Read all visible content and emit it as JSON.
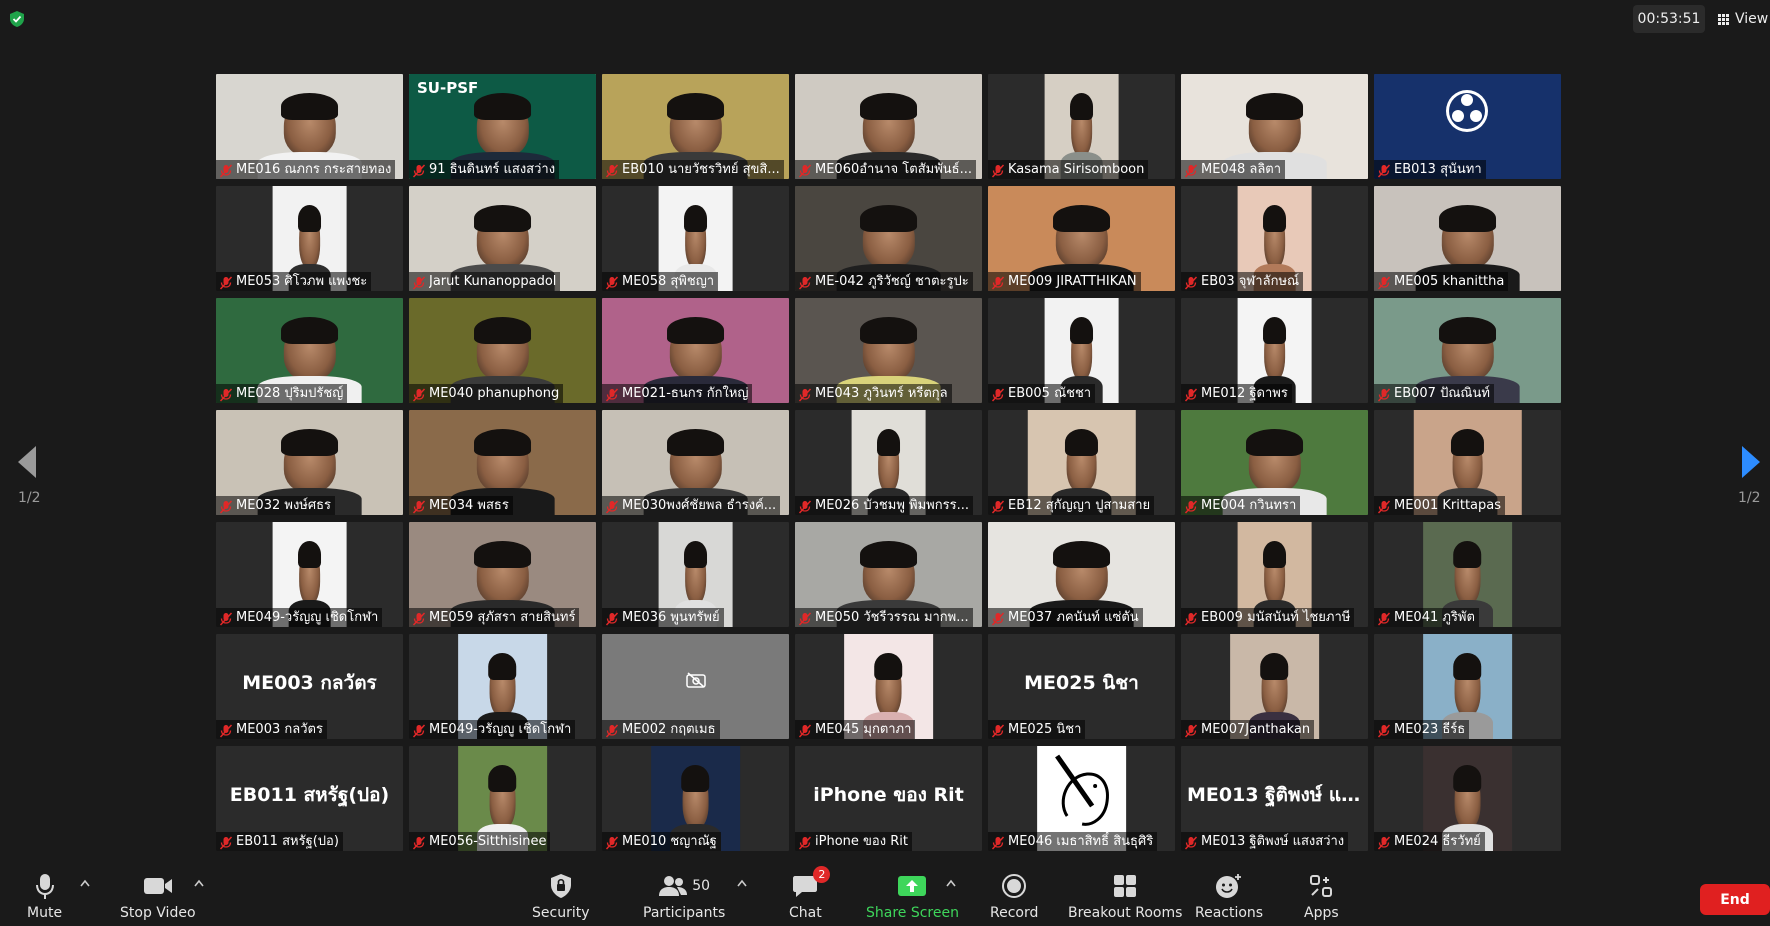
{
  "meeting": {
    "timer": "00:53:51",
    "view_label": "View",
    "page_indicator_left": "1/2",
    "page_indicator_right": "1/2"
  },
  "colors": {
    "background": "#1a1a1a",
    "tile_background": "#2b2b2b",
    "active_speaker_border": "#c8e04a",
    "muted_mic": "#e02828",
    "share_screen": "#3ed65b",
    "end_button": "#e02020",
    "nav_arrow_right": "#2d8cff",
    "nav_arrow_left": "#9a9a9a"
  },
  "tiles": [
    {
      "name": "ME016 ณภกร กระสายทอง",
      "video": "cam",
      "bg": "#d8d6d0",
      "shirt": "#f2f2f2",
      "w": "full"
    },
    {
      "name": "91 ธินดินทร์ แสงสว่าง",
      "video": "cam",
      "bg": "#0d5a45",
      "shirt": "#1d2a3a",
      "w": "full",
      "overlay": "SU-PSF",
      "active": true
    },
    {
      "name": "EB010 นายวัชรวิทย์ สุขสิ...",
      "video": "cam",
      "bg": "#b8a35a",
      "shirt": "#3a3a3a",
      "w": "full"
    },
    {
      "name": "ME060อำนาจ โตสัมพันธ์...",
      "video": "cam",
      "bg": "#cfcac2",
      "shirt": "#2a2a2a",
      "w": "full"
    },
    {
      "name": "Kasama Sirisomboon",
      "video": "cam",
      "bg": "#d6cfc4",
      "shirt": "#8a8f8a",
      "w": "w40"
    },
    {
      "name": "ME048 ลลิตา",
      "video": "cam",
      "bg": "#e8e3dc",
      "shirt": "#e0e0e0",
      "w": "full"
    },
    {
      "name": "EB013 สุนันทา",
      "video": "logo",
      "bg": "#16316b",
      "w": "full"
    },
    {
      "name": "ME053 ศิโวภพ แพงชะ",
      "video": "cam",
      "bg": "#f2f2f2",
      "shirt": "#2d2d2d",
      "w": "w40"
    },
    {
      "name": "Jarut Kunanoppadol",
      "video": "cam",
      "bg": "#d4d0c8",
      "shirt": "#4a4a4a",
      "w": "full"
    },
    {
      "name": "ME058 สุพิชญา",
      "video": "cam",
      "bg": "#f3f3f3",
      "shirt": "#e8e8e8",
      "w": "w40"
    },
    {
      "name": "ME-042 ภูริวัชญ์ ชาตะรูปะ",
      "video": "cam",
      "bg": "#4a4640",
      "shirt": "#1f1f1f",
      "w": "full"
    },
    {
      "name": "ME009 JIRATTHIKAN",
      "video": "cam",
      "bg": "#c98a5a",
      "shirt": "#1a1a1a",
      "w": "full"
    },
    {
      "name": "EB03 จุฬาลักษณ์",
      "video": "cam",
      "bg": "#e8c9b8",
      "shirt": "#b27a5a",
      "w": "w40"
    },
    {
      "name": "ME005 khanittha",
      "video": "cam",
      "bg": "#c8c2bc",
      "shirt": "#1a1a1a",
      "w": "full"
    },
    {
      "name": "ME028 ปุริมปรัชญ์",
      "video": "cam",
      "bg": "#2f6a3f",
      "shirt": "#f0f0f0",
      "w": "full"
    },
    {
      "name": "ME040 phanuphong",
      "video": "cam",
      "bg": "#6a6a2a",
      "shirt": "#3a3a3a",
      "w": "full"
    },
    {
      "name": "ME021-ธนกร กักใหญ่",
      "video": "cam",
      "bg": "#b0628a",
      "shirt": "#2a2a3a",
      "w": "full"
    },
    {
      "name": "ME043 ภูวินทร์ หรีตกุล",
      "video": "cam",
      "bg": "#5a5550",
      "shirt": "#d9d37a",
      "w": "full"
    },
    {
      "name": "EB005 ณัชชา",
      "video": "cam",
      "bg": "#f2f2f2",
      "shirt": "#2a2a2a",
      "w": "w40"
    },
    {
      "name": "ME012 ฐิดาพร",
      "video": "cam",
      "bg": "#f4f4f4",
      "shirt": "#1a1a1a",
      "w": "w40"
    },
    {
      "name": "EB007 ปัณณินท์",
      "video": "cam",
      "bg": "#7a9a8a",
      "shirt": "#3a3a4a",
      "w": "full"
    },
    {
      "name": "ME032 พงษ์ศธร",
      "video": "cam",
      "bg": "#c9c2b6",
      "shirt": "#2a2a2a",
      "w": "full"
    },
    {
      "name": "ME034 พสธร",
      "video": "cam",
      "bg": "#8a6a4a",
      "shirt": "#1a1a1a",
      "w": "full"
    },
    {
      "name": "ME030พงศ์ชัยพล ธำรงค์...",
      "video": "cam",
      "bg": "#c6c0b6",
      "shirt": "#3a3a3a",
      "w": "full"
    },
    {
      "name": "ME026 บัวชมพู พิมพกรร...",
      "video": "cam",
      "bg": "#e0ded8",
      "shirt": "#2a2a2a",
      "w": "w40"
    },
    {
      "name": "EB12 สุกัญญา ปูสามสาย",
      "video": "cam",
      "bg": "#d7c5b0",
      "shirt": "#2a2a2a",
      "w": "w58"
    },
    {
      "name": "ME004 กวินทรา",
      "video": "cam",
      "bg": "#4e7a3e",
      "shirt": "#e8e8e8",
      "w": "full"
    },
    {
      "name": "ME001 Krittapas",
      "video": "cam",
      "bg": "#c9a48a",
      "shirt": "#3a3a3a",
      "w": "w58"
    },
    {
      "name": "ME049-วรัญญู เชิดโกฬา",
      "video": "cam",
      "bg": "#f4f4f4",
      "shirt": "#1a1a1a",
      "w": "w40"
    },
    {
      "name": "ME059 สุภัสรา สายสินทร์",
      "video": "cam",
      "bg": "#9a8a80",
      "shirt": "#2a2a2a",
      "w": "full"
    },
    {
      "name": "ME036 พูนทรัพย์",
      "video": "cam",
      "bg": "#d8d8d6",
      "shirt": "#e0e0e0",
      "w": "w40"
    },
    {
      "name": "ME050 วัชรีวรรณ มากพ...",
      "video": "cam",
      "bg": "#a8a8a4",
      "shirt": "#3a3a3a",
      "w": "full"
    },
    {
      "name": "ME037 ภคนันท์ แซ่ตัน",
      "video": "cam",
      "bg": "#e6e4e0",
      "shirt": "#1a1a1a",
      "w": "full"
    },
    {
      "name": "EB009 มนัสนันท์ ไชยภาษี",
      "video": "cam",
      "bg": "#d2b8a0",
      "shirt": "#2a2a2a",
      "w": "w40"
    },
    {
      "name": "ME041 ภูริพัต",
      "video": "cam",
      "bg": "#5a6a50",
      "shirt": "#3a3a3a",
      "w": "w48"
    },
    {
      "name": "ME003 กลวัตร",
      "video": "off",
      "big": "ME003 กลวัตร"
    },
    {
      "name": "ME049-วรัญญู เชิดโกฬา",
      "video": "cam",
      "bg": "#c8d8e8",
      "shirt": "#1a1a1a",
      "w": "w48"
    },
    {
      "name": "ME002 กฤตเมธ",
      "video": "cam-off-icon",
      "bg": "#7a7a7a",
      "w": "full"
    },
    {
      "name": "ME045 มุกตาภา",
      "video": "cam",
      "bg": "#f3e6e6",
      "shirt": "#d9b0b0",
      "w": "w48"
    },
    {
      "name": "ME025 นิชา",
      "video": "off",
      "big": "ME025 นิชา"
    },
    {
      "name": "ME007Janthakan",
      "video": "cam",
      "bg": "#c9b8a8",
      "shirt": "#3a3040",
      "w": "w48"
    },
    {
      "name": "ME023 ธีร์ธ",
      "video": "cam",
      "bg": "#8ab0c8",
      "shirt": "#9a9a9a",
      "w": "w48"
    },
    {
      "name": "EB011 สหรัฐ(ปอ)",
      "video": "off",
      "big": "EB011 สหรัฐ(ปอ)"
    },
    {
      "name": "ME056-Sitthisinee",
      "video": "cam",
      "bg": "#6a8a4a",
      "shirt": "#f0f0f0",
      "w": "w48"
    },
    {
      "name": "ME010 ชญาณัฐ",
      "video": "cam",
      "bg": "#1a2a4a",
      "shirt": "#2a2a2a",
      "w": "w48"
    },
    {
      "name": "iPhone ของ Rit",
      "video": "off",
      "big": "iPhone ของ Rit"
    },
    {
      "name": "ME046 เมธาสิทธิ์ สินธุศิริ",
      "video": "drawing",
      "bg": "#ffffff",
      "w": "w48"
    },
    {
      "name": "ME013 ฐิติพงษ์ แสงสว่าง",
      "video": "off",
      "big": "ME013 ฐิติพงษ์ แ..."
    },
    {
      "name": "ME024 ธีรวัทย์",
      "video": "cam",
      "bg": "#3a3030",
      "shirt": "#e0e0e0",
      "w": "w48"
    }
  ],
  "toolbar": {
    "mute": "Mute",
    "stop_video": "Stop Video",
    "security": "Security",
    "participants": "Participants",
    "participants_count": "50",
    "chat": "Chat",
    "chat_badge": "2",
    "share_screen": "Share Screen",
    "record": "Record",
    "breakout_rooms": "Breakout Rooms",
    "reactions": "Reactions",
    "apps": "Apps",
    "end": "End"
  }
}
